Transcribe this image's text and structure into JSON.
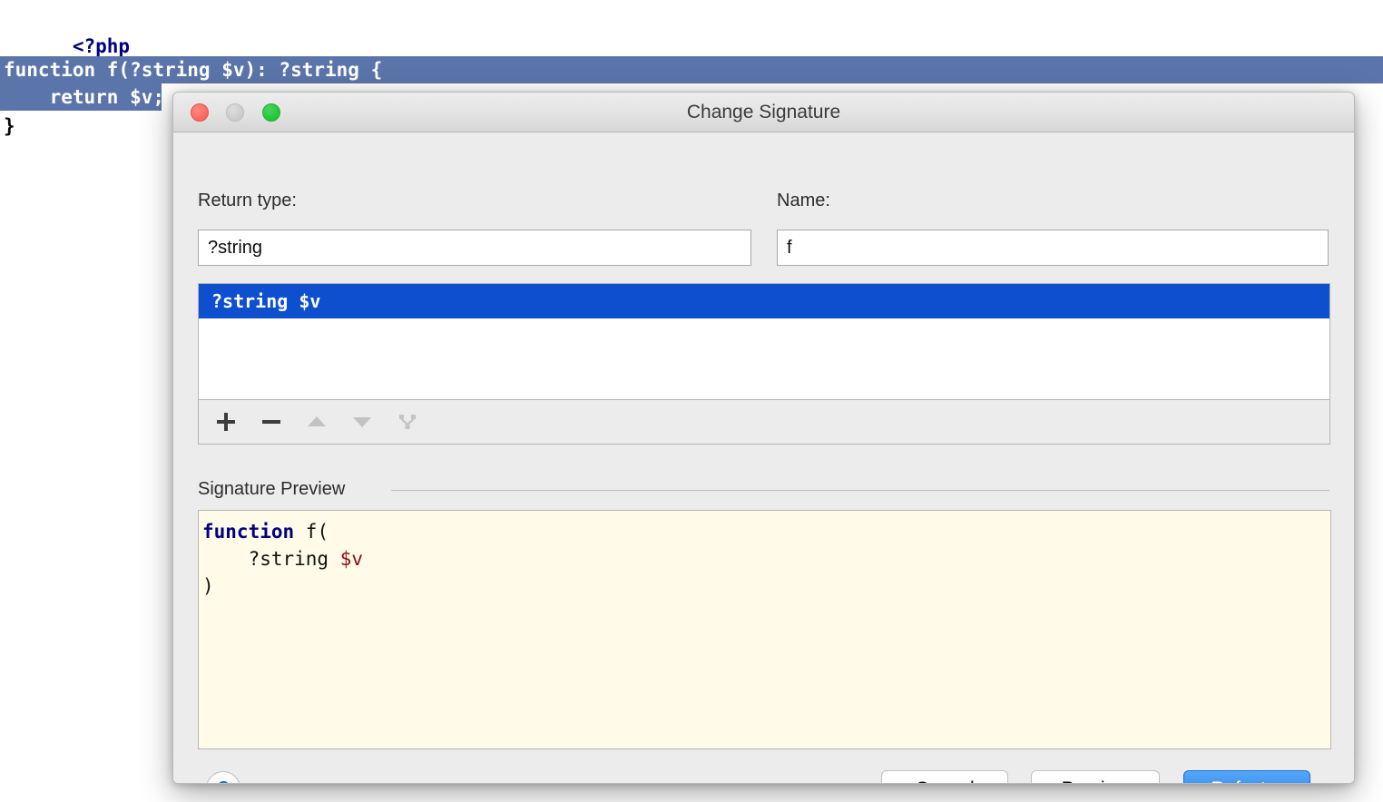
{
  "editor": {
    "lines": [
      {
        "text": "<?php",
        "style": "php-open"
      },
      {
        "text": "function f(?string $v): ?string {",
        "style": "selected-full"
      },
      {
        "text": "    return $v;",
        "style": "selected-part"
      },
      {
        "text": "}",
        "style": "plain"
      }
    ]
  },
  "dialog": {
    "title": "Change Signature",
    "window_controls": {
      "close": "close-button",
      "minimize": "minimize-button",
      "maximize": "maximize-button"
    },
    "return_type": {
      "label": "Return type:",
      "value": "?string"
    },
    "name": {
      "label": "Name:",
      "value": "f"
    },
    "parameters": {
      "rows": [
        {
          "text": "?string $v",
          "selected": true
        }
      ],
      "toolbar": [
        {
          "name": "add-parameter-button",
          "icon": "plus-icon",
          "label": "+",
          "enabled": true
        },
        {
          "name": "remove-parameter-button",
          "icon": "minus-icon",
          "label": "–",
          "enabled": true
        },
        {
          "name": "move-parameter-up-button",
          "icon": "arrow-up-icon",
          "label": "▲",
          "enabled": false
        },
        {
          "name": "move-parameter-down-button",
          "icon": "arrow-down-icon",
          "label": "▼",
          "enabled": false
        },
        {
          "name": "propagate-parameter-button",
          "icon": "fork-branch-icon",
          "label": "Y",
          "enabled": false
        }
      ]
    },
    "signature_preview": {
      "title": "Signature Preview",
      "code": {
        "line1_keyword": "function",
        "line1_rest": " f(",
        "line2_type": "    ?string ",
        "line2_var": "$v",
        "line3": ")"
      }
    },
    "footer": {
      "help_label": "?",
      "cancel_label": "Cancel",
      "preview_label": "Preview",
      "refactor_label": "Refactor"
    }
  },
  "colors": {
    "editor_selection": "#5b75ab",
    "list_selection": "#0d4fce",
    "preview_background": "#fffbe8",
    "default_button": "#1a7aef",
    "keyword": "#000080",
    "variable": "#8b0f18",
    "help_glyph": "#0a72d8"
  }
}
